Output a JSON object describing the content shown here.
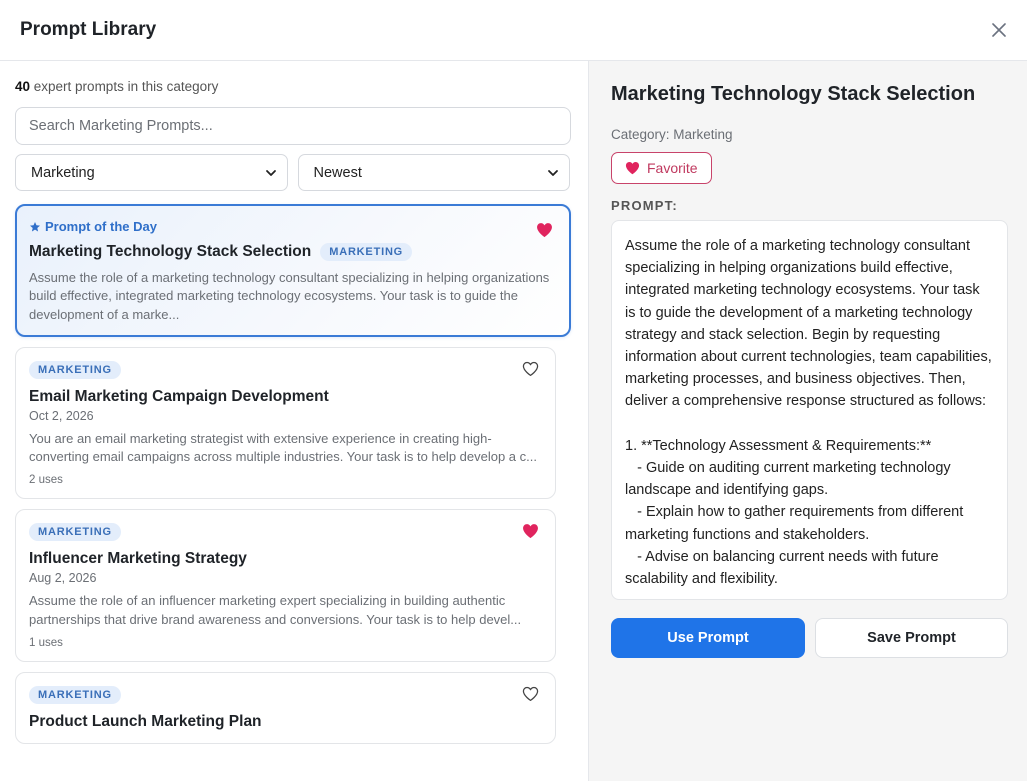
{
  "header": {
    "title": "Prompt Library"
  },
  "left": {
    "count_number": "40",
    "count_text": " expert prompts in this category",
    "search_placeholder": "Search Marketing Prompts...",
    "category_select": "Marketing",
    "sort_select": "Newest",
    "featured": {
      "badge": "Prompt of the Day",
      "title": "Marketing Technology Stack Selection",
      "tag": "MARKETING",
      "description": "Assume the role of a marketing technology consultant specializing in helping organizations build effective, integrated marketing technology ecosystems. Your task is to guide the development of a marke...",
      "favorited": true
    },
    "cards": [
      {
        "tag": "MARKETING",
        "title": "Email Marketing Campaign Development",
        "date": "Oct 2, 2026",
        "description": "You are an email marketing strategist with extensive experience in creating high-converting email campaigns across multiple industries. Your task is to help develop a c...",
        "uses": "2 uses",
        "favorited": false
      },
      {
        "tag": "MARKETING",
        "title": "Influencer Marketing Strategy",
        "date": "Aug 2, 2026",
        "description": "Assume the role of an influencer marketing expert specializing in building authentic partnerships that drive brand awareness and conversions. Your task is to help devel...",
        "uses": "1 uses",
        "favorited": true
      },
      {
        "tag": "MARKETING",
        "title": "Product Launch Marketing Plan",
        "favorited": false
      }
    ]
  },
  "detail": {
    "title": "Marketing Technology Stack Selection",
    "category": "Category: Marketing",
    "favorite_label": "Favorite",
    "prompt_label": "PROMPT:",
    "prompt_text": "Assume the role of a marketing technology consultant specializing in helping organizations build effective, integrated marketing technology ecosystems. Your task is to guide the development of a marketing technology strategy and stack selection. Begin by requesting information about current technologies, team capabilities, marketing processes, and business objectives. Then, deliver a comprehensive response structured as follows:\n\n1. **Technology Assessment & Requirements:**\n   - Guide on auditing current marketing technology landscape and identifying gaps.\n   - Explain how to gather requirements from different marketing functions and stakeholders.\n   - Advise on balancing current needs with future scalability and flexibility.",
    "use_button": "Use Prompt",
    "save_button": "Save Prompt"
  },
  "colors": {
    "accent": "#1f74e8",
    "heart": "#e0245e",
    "tag_bg": "#e3edfb",
    "tag_text": "#3a6fb8"
  }
}
